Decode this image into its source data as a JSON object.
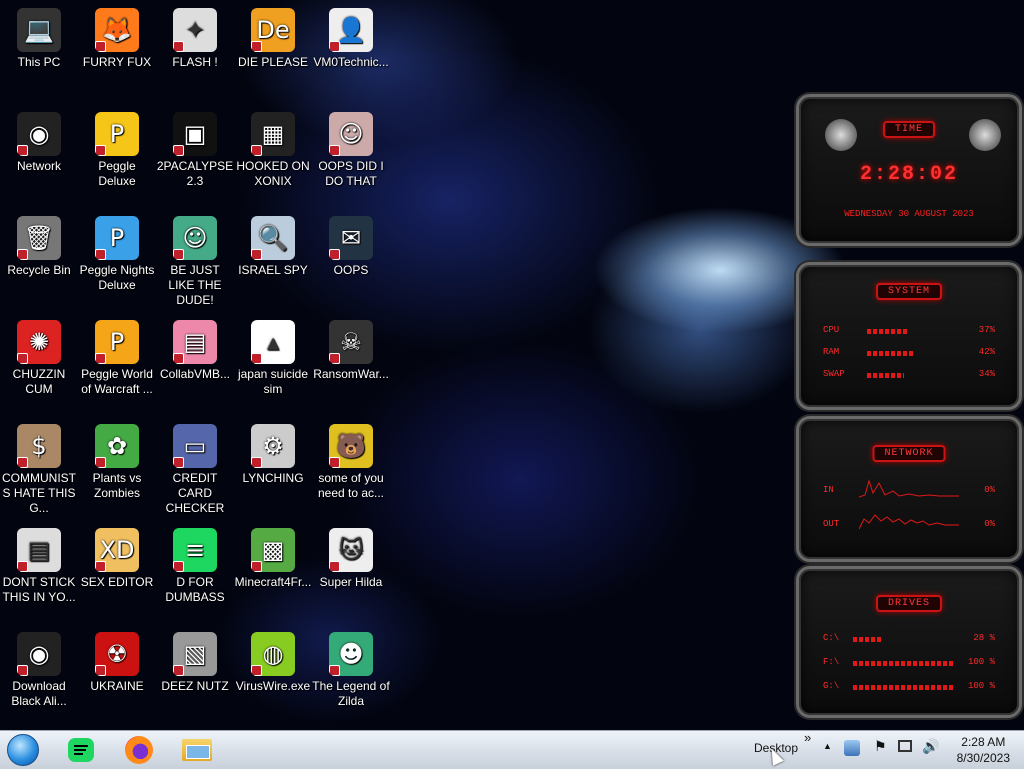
{
  "desktop": {
    "icons": [
      {
        "label": "This PC"
      },
      {
        "label": "FURRY FUX"
      },
      {
        "label": "FLASH !"
      },
      {
        "label": "DIE PLEASE"
      },
      {
        "label": "VM0Technic..."
      },
      {
        "label": "Network"
      },
      {
        "label": "Peggle Deluxe"
      },
      {
        "label": "2PACALYPSE 2.3"
      },
      {
        "label": "HOOKED ON XONIX"
      },
      {
        "label": "OOPS DID I DO THAT"
      },
      {
        "label": "Recycle Bin"
      },
      {
        "label": "Peggle Nights Deluxe"
      },
      {
        "label": "BE JUST LIKE THE DUDE!"
      },
      {
        "label": "ISRAEL SPY"
      },
      {
        "label": "OOPS"
      },
      {
        "label": "CHUZZIN CUM"
      },
      {
        "label": "Peggle World of Warcraft ..."
      },
      {
        "label": "CollabVMB..."
      },
      {
        "label": "japan suicide sim"
      },
      {
        "label": "RansomWar..."
      },
      {
        "label": "COMMUNISTS HATE THIS G..."
      },
      {
        "label": "Plants vs Zombies"
      },
      {
        "label": "CREDIT CARD CHECKER"
      },
      {
        "label": "LYNCHING"
      },
      {
        "label": "some of you need to ac..."
      },
      {
        "label": "DONT STICK THIS IN YO..."
      },
      {
        "label": "SEX EDITOR"
      },
      {
        "label": "D FOR DUMBASS"
      },
      {
        "label": "Minecraft4Fr..."
      },
      {
        "label": "Super Hilda"
      },
      {
        "label": "Download Black Ali..."
      },
      {
        "label": "UKRAINE"
      },
      {
        "label": "DEEZ NUTZ"
      },
      {
        "label": "VirusWire.exe"
      },
      {
        "label": "The Legend of Zilda"
      }
    ]
  },
  "gadgets": {
    "time": {
      "title": "TIME",
      "clock": "2:28:02",
      "date": "WEDNESDAY 30 AUGUST 2023"
    },
    "system": {
      "title": "SYSTEM",
      "rows": [
        {
          "key": "CPU",
          "value": "37%",
          "level": 0.37
        },
        {
          "key": "RAM",
          "value": "42%",
          "level": 0.42
        },
        {
          "key": "SWAP",
          "value": "34%",
          "level": 0.34
        }
      ]
    },
    "network": {
      "title": "NETWORK",
      "in_label": "IN",
      "in_value": "0%",
      "out_label": "OUT",
      "out_value": "0%"
    },
    "drives": {
      "title": "DRIVES",
      "rows": [
        {
          "key": "C:\\",
          "value": "28 %",
          "level": 0.28
        },
        {
          "key": "F:\\",
          "value": "100 %",
          "level": 1.0
        },
        {
          "key": "G:\\",
          "value": "100 %",
          "level": 1.0
        }
      ]
    }
  },
  "taskbar": {
    "toolbar_label": "Desktop",
    "overflow": "»",
    "time": "2:28 AM",
    "date": "8/30/2023"
  },
  "colors": {
    "accent": "#e01818",
    "taskbar": "#dde3eb"
  }
}
